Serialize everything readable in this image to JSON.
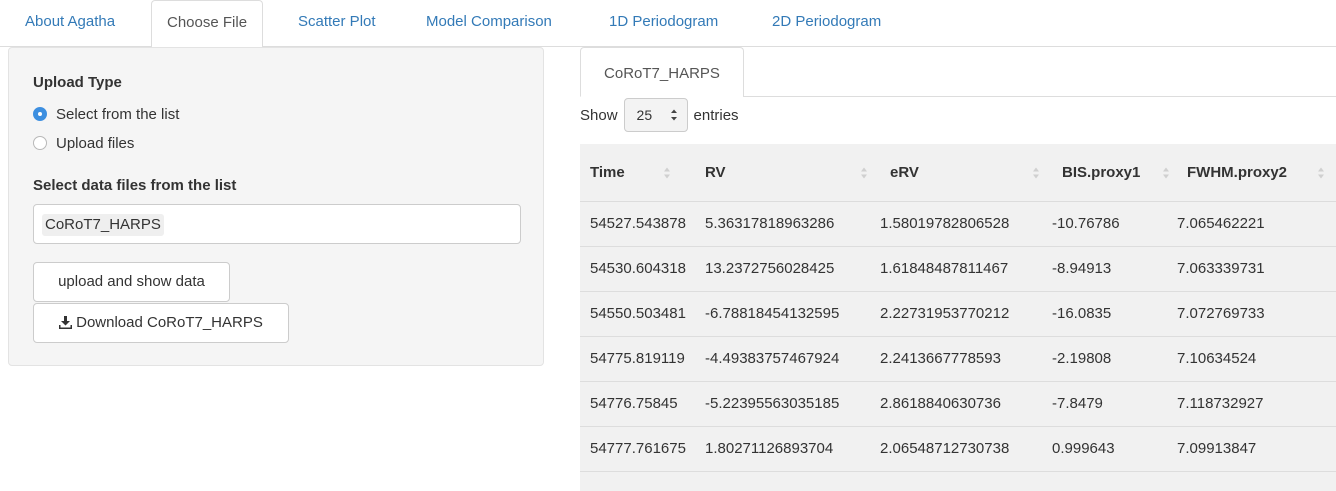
{
  "nav": {
    "tabs": [
      {
        "label": "About Agatha"
      },
      {
        "label": "Choose File"
      },
      {
        "label": "Scatter Plot"
      },
      {
        "label": "Model Comparison"
      },
      {
        "label": "1D Periodogram"
      },
      {
        "label": "2D Periodogram"
      }
    ],
    "active_tab": "Choose File"
  },
  "upload": {
    "title": "Upload Type",
    "options": [
      {
        "label": "Select from the list",
        "checked": true
      },
      {
        "label": "Upload files",
        "checked": false
      }
    ],
    "select_label": "Select data files from the list",
    "selected_file": "CoRoT7_HARPS",
    "upload_button": "upload and show data",
    "download_button": "Download CoRoT7_HARPS"
  },
  "data_view": {
    "tab_label": "CoRoT7_HARPS",
    "show_prefix": "Show",
    "page_length": "25",
    "show_suffix": "entries",
    "columns": [
      "Time",
      "RV",
      "eRV",
      "BIS.proxy1",
      "FWHM.proxy2"
    ],
    "rows": [
      [
        "54527.543878",
        "5.36317818963286",
        "1.58019782806528",
        "-10.76786",
        "7.065462221"
      ],
      [
        "54530.604318",
        "13.2372756028425",
        "1.61848487811467",
        "-8.94913",
        "7.063339731"
      ],
      [
        "54550.503481",
        "-6.78818454132595",
        "2.22731953770212",
        "-16.0835",
        "7.072769733"
      ],
      [
        "54775.819119",
        "-4.49383757467924",
        "2.2413667778593",
        "-2.19808",
        "7.10634524"
      ],
      [
        "54776.75845",
        "-5.22395563035185",
        "2.8618840630736",
        "-7.8479",
        "7.118732927"
      ],
      [
        "54777.761675",
        "1.80271126893704",
        "2.06548712730738",
        "0.999643",
        "7.09913847"
      ]
    ]
  },
  "colors": {
    "link": "#337ab7",
    "radio_checked": "#3d8fe0",
    "table_bg": "#f1f1f1"
  }
}
